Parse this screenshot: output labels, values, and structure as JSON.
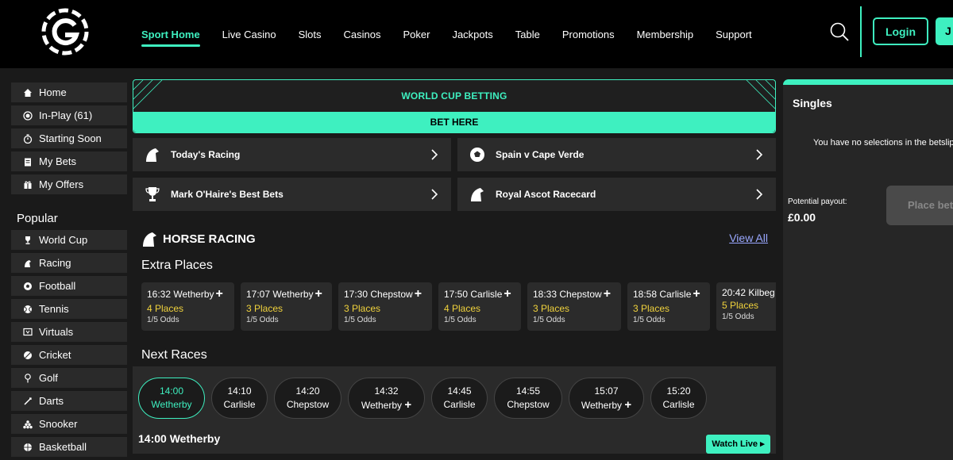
{
  "nav": [
    "Sport Home",
    "Live Casino",
    "Slots",
    "Casinos",
    "Poker",
    "Jackpots",
    "Table",
    "Promotions",
    "Membership",
    "Support"
  ],
  "auth": {
    "login": "Login",
    "join": "J"
  },
  "sidebar": {
    "items": [
      "Home",
      "In-Play (61)",
      "Starting Soon",
      "My Bets",
      "My Offers"
    ],
    "popular_title": "Popular",
    "popular": [
      "World Cup",
      "Racing",
      "Football",
      "Tennis",
      "Virtuals",
      "Cricket",
      "Golf",
      "Darts",
      "Snooker",
      "Basketball"
    ]
  },
  "banner": {
    "title": "WORLD CUP BETTING",
    "button": "BET HERE"
  },
  "quick_links": [
    "Today's Racing",
    "Spain v Cape Verde",
    "Mark O'Haire's Best Bets",
    "Royal Ascot Racecard"
  ],
  "horse_racing": {
    "title": "HORSE RACING",
    "view_all": "View All",
    "extra_places_title": "Extra Places",
    "extra_places": [
      {
        "race": "16:32 Wetherby",
        "places": "4 Places",
        "odds": "1/5 Odds"
      },
      {
        "race": "17:07 Wetherby",
        "places": "3 Places",
        "odds": "1/5 Odds"
      },
      {
        "race": "17:30 Chepstow",
        "places": "3 Places",
        "odds": "1/5 Odds"
      },
      {
        "race": "17:50 Carlisle",
        "places": "4 Places",
        "odds": "1/5 Odds"
      },
      {
        "race": "18:33 Chepstow",
        "places": "3 Places",
        "odds": "1/5 Odds"
      },
      {
        "race": "18:58 Carlisle",
        "places": "3 Places",
        "odds": "1/5 Odds"
      },
      {
        "race": "20:42 Kilbeg",
        "places": "5 Places",
        "odds": "1/5 Odds"
      }
    ],
    "next_races_title": "Next Races",
    "next_races": [
      {
        "time": "14:00",
        "course": "Wetherby"
      },
      {
        "time": "14:10",
        "course": "Carlisle"
      },
      {
        "time": "14:20",
        "course": "Chepstow"
      },
      {
        "time": "14:32",
        "course": "Wetherby"
      },
      {
        "time": "14:45",
        "course": "Carlisle"
      },
      {
        "time": "14:55",
        "course": "Chepstow"
      },
      {
        "time": "15:07",
        "course": "Wetherby"
      },
      {
        "time": "15:20",
        "course": "Carlisle"
      }
    ],
    "selected_race": "14:00 Wetherby",
    "watch_live": "Watch Live ▸"
  },
  "betslip": {
    "title": "Singles",
    "empty": "You have no selections in the betslip",
    "potential_label": "Potential payout:",
    "potential_value": "£0.00",
    "place_bet": "Place bet"
  },
  "colors": {
    "accent": "#3ef0c0",
    "places": "#f0d23c",
    "panel": "#2b2b2b",
    "background": "#1a1a1a"
  }
}
